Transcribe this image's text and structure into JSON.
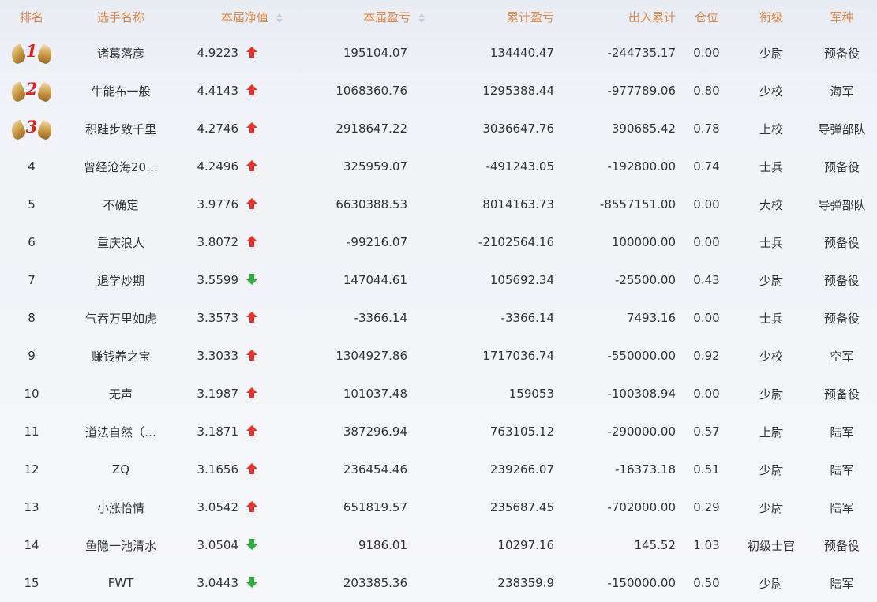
{
  "colors": {
    "header_text": "#e2894a",
    "up_arrow": "#e2322d",
    "down_arrow": "#2fae3c",
    "medal_number": "#d8231f"
  },
  "headers": {
    "rank": "排名",
    "name": "选手名称",
    "nav": "本届净值",
    "profit": "本届盈亏",
    "cumulative": "累计盈亏",
    "flow": "出入累计",
    "position": "仓位",
    "grade": "衔级",
    "branch": "军种"
  },
  "rows": [
    {
      "rank": "1",
      "medal": true,
      "name": "诸葛落彦",
      "nav": "4.9223",
      "trend": "up",
      "profit": "195104.07",
      "cumulative": "134440.47",
      "flow": "-244735.17",
      "position": "0.00",
      "grade": "少尉",
      "branch": "预备役"
    },
    {
      "rank": "2",
      "medal": true,
      "name": "牛能布一般",
      "nav": "4.4143",
      "trend": "up",
      "profit": "1068360.76",
      "cumulative": "1295388.44",
      "flow": "-977789.06",
      "position": "0.80",
      "grade": "少校",
      "branch": "海军"
    },
    {
      "rank": "3",
      "medal": true,
      "name": "积跬步致千里",
      "nav": "4.2746",
      "trend": "up",
      "profit": "2918647.22",
      "cumulative": "3036647.76",
      "flow": "390685.42",
      "position": "0.78",
      "grade": "上校",
      "branch": "导弹部队"
    },
    {
      "rank": "4",
      "medal": false,
      "name": "曾经沧海20…",
      "nav": "4.2496",
      "trend": "up",
      "profit": "325959.07",
      "cumulative": "-491243.05",
      "flow": "-192800.00",
      "position": "0.74",
      "grade": "士兵",
      "branch": "预备役"
    },
    {
      "rank": "5",
      "medal": false,
      "name": "不确定",
      "nav": "3.9776",
      "trend": "up",
      "profit": "6630388.53",
      "cumulative": "8014163.73",
      "flow": "-8557151.00",
      "position": "0.00",
      "grade": "大校",
      "branch": "导弹部队"
    },
    {
      "rank": "6",
      "medal": false,
      "name": "重庆浪人",
      "nav": "3.8072",
      "trend": "up",
      "profit": "-99216.07",
      "cumulative": "-2102564.16",
      "flow": "100000.00",
      "position": "0.00",
      "grade": "士兵",
      "branch": "预备役"
    },
    {
      "rank": "7",
      "medal": false,
      "name": "退学炒期",
      "nav": "3.5599",
      "trend": "down",
      "profit": "147044.61",
      "cumulative": "105692.34",
      "flow": "-25500.00",
      "position": "0.43",
      "grade": "少尉",
      "branch": "预备役"
    },
    {
      "rank": "8",
      "medal": false,
      "name": "气吞万里如虎",
      "nav": "3.3573",
      "trend": "up",
      "profit": "-3366.14",
      "cumulative": "-3366.14",
      "flow": "7493.16",
      "position": "0.00",
      "grade": "士兵",
      "branch": "预备役"
    },
    {
      "rank": "9",
      "medal": false,
      "name": "赚钱养之宝",
      "nav": "3.3033",
      "trend": "up",
      "profit": "1304927.86",
      "cumulative": "1717036.74",
      "flow": "-550000.00",
      "position": "0.92",
      "grade": "少校",
      "branch": "空军"
    },
    {
      "rank": "10",
      "medal": false,
      "name": "无声",
      "nav": "3.1987",
      "trend": "up",
      "profit": "101037.48",
      "cumulative": "159053",
      "flow": "-100308.94",
      "position": "0.00",
      "grade": "少尉",
      "branch": "预备役"
    },
    {
      "rank": "11",
      "medal": false,
      "name": "道法自然（…",
      "nav": "3.1871",
      "trend": "up",
      "profit": "387296.94",
      "cumulative": "763105.12",
      "flow": "-290000.00",
      "position": "0.57",
      "grade": "上尉",
      "branch": "陆军"
    },
    {
      "rank": "12",
      "medal": false,
      "name": "ZQ",
      "nav": "3.1656",
      "trend": "up",
      "profit": "236454.46",
      "cumulative": "239266.07",
      "flow": "-16373.18",
      "position": "0.51",
      "grade": "少尉",
      "branch": "陆军"
    },
    {
      "rank": "13",
      "medal": false,
      "name": "小涨怡情",
      "nav": "3.0542",
      "trend": "up",
      "profit": "651819.57",
      "cumulative": "235687.45",
      "flow": "-702000.00",
      "position": "0.29",
      "grade": "少尉",
      "branch": "陆军"
    },
    {
      "rank": "14",
      "medal": false,
      "name": "鱼隐一池清水",
      "nav": "3.0504",
      "trend": "down",
      "profit": "9186.01",
      "cumulative": "10297.16",
      "flow": "145.52",
      "position": "1.03",
      "grade": "初级士官",
      "branch": "预备役"
    },
    {
      "rank": "15",
      "medal": false,
      "name": "FWT",
      "nav": "3.0443",
      "trend": "down",
      "profit": "203385.36",
      "cumulative": "238359.9",
      "flow": "-150000.00",
      "position": "0.50",
      "grade": "少尉",
      "branch": "陆军"
    }
  ]
}
